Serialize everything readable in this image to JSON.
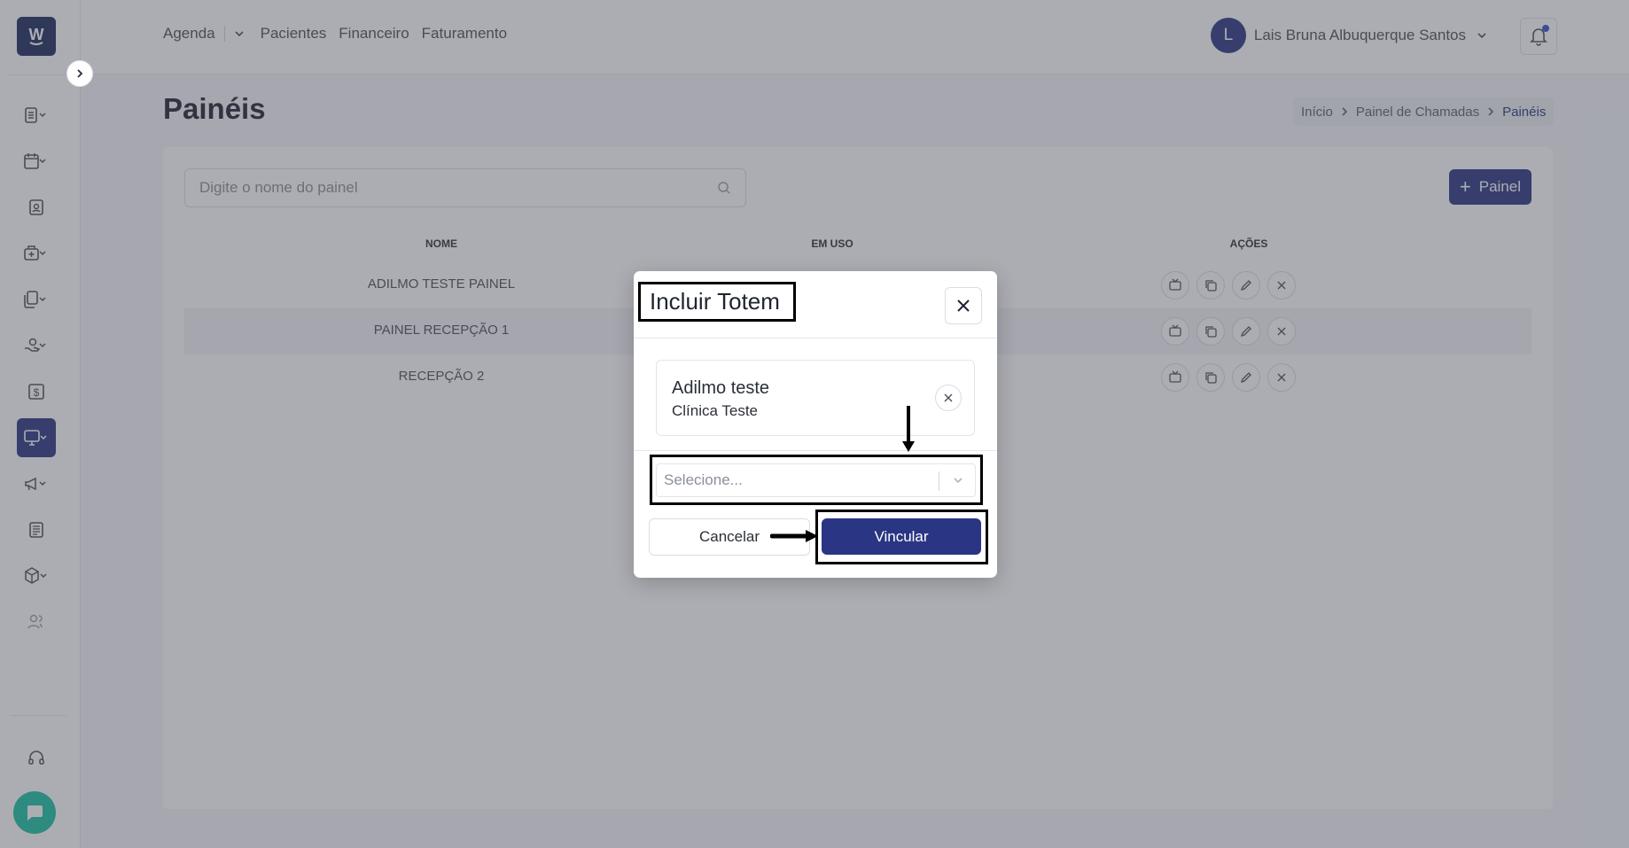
{
  "colors": {
    "primary": "#2a3583",
    "logo_bg": "#1d2b5e",
    "chat_bubble": "#19c2a3",
    "overlay": "rgba(70,74,84,0.45)",
    "annotation": "#000000"
  },
  "sidebar": {
    "logo_letter": "W",
    "items": [
      {
        "icon": "document-list-icon",
        "has_dropdown": true
      },
      {
        "icon": "calendar-icon",
        "has_dropdown": true
      },
      {
        "icon": "patient-badge-icon",
        "has_dropdown": false
      },
      {
        "icon": "medical-bag-icon",
        "has_dropdown": true
      },
      {
        "icon": "documents-icon",
        "has_dropdown": true
      },
      {
        "icon": "hand-money-icon",
        "has_dropdown": true
      },
      {
        "icon": "dollar-icon",
        "has_dropdown": false
      },
      {
        "icon": "monitor-icon",
        "has_dropdown": true,
        "active": true
      },
      {
        "icon": "megaphone-icon",
        "has_dropdown": true
      },
      {
        "icon": "newspaper-icon",
        "has_dropdown": false
      },
      {
        "icon": "box-icon",
        "has_dropdown": true
      },
      {
        "icon": "users-icon",
        "has_dropdown": false
      }
    ],
    "support_icon": "headset-icon",
    "chat_icon": "chat-icon"
  },
  "topbar": {
    "nav": [
      "Agenda",
      "Pacientes",
      "Financeiro",
      "Faturamento"
    ],
    "user_initial": "L",
    "user_name": "Lais Bruna Albuquerque Santos"
  },
  "page": {
    "title": "Painéis",
    "breadcrumb": [
      "Início",
      "Painel de Chamadas",
      "Painéis"
    ]
  },
  "toolbar": {
    "search_placeholder": "Digite o nome do painel",
    "add_label": "Painel"
  },
  "table": {
    "headers": [
      "NOME",
      "EM USO",
      "AÇÕES"
    ],
    "rows": [
      {
        "name": "ADILMO TESTE PAINEL"
      },
      {
        "name": "PAINEL RECEPÇÃO 1"
      },
      {
        "name": "RECEPÇÃO 2"
      }
    ],
    "action_icons": [
      "tv-icon",
      "copy-icon",
      "pencil-icon",
      "close-icon"
    ]
  },
  "modal": {
    "title": "Incluir Totem",
    "totem_name": "Adilmo teste",
    "totem_clinic": "Clínica Teste",
    "select_placeholder": "Selecione...",
    "cancel_label": "Cancelar",
    "confirm_label": "Vincular"
  }
}
